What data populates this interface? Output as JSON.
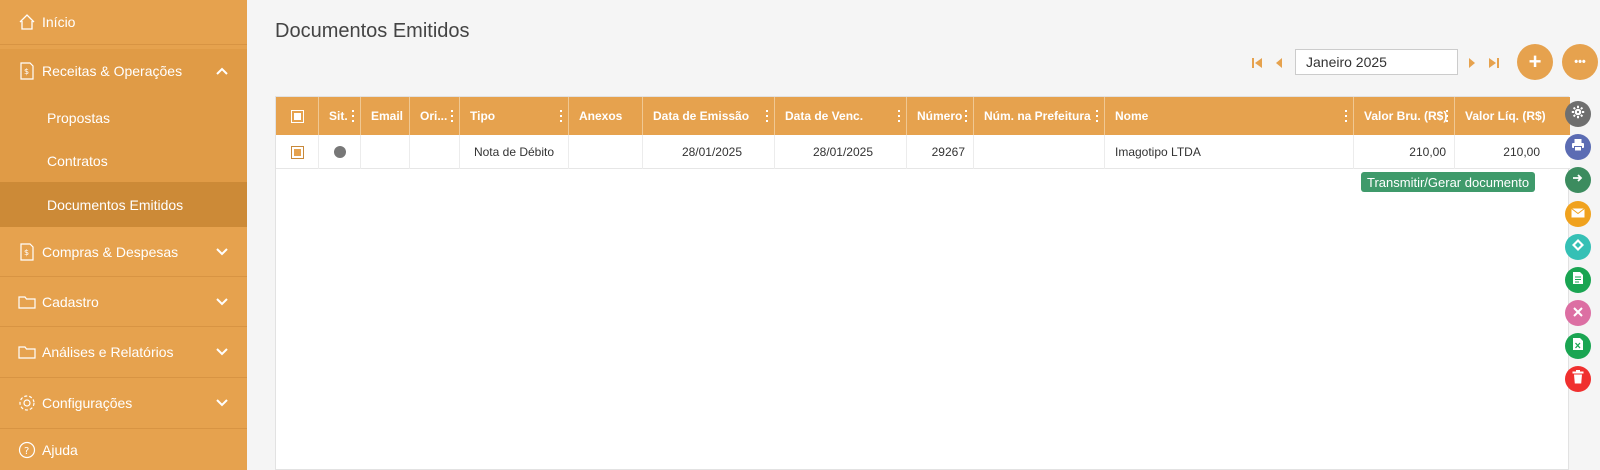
{
  "sidebar": {
    "inicio": "Início",
    "receitas": "Receitas & Operações",
    "propostas": "Propostas",
    "contratos": "Contratos",
    "documentos": "Documentos Emitidos",
    "compras": "Compras & Despesas",
    "cadastro": "Cadastro",
    "analises": "Análises e Relatórios",
    "configuracoes": "Configurações",
    "ajuda": "Ajuda"
  },
  "page": {
    "title": "Documentos Emitidos",
    "month": "Janeiro 2025",
    "add_label": "+",
    "more_label": "•••"
  },
  "table": {
    "headers": {
      "sit": "Sit.",
      "email": "Email",
      "ori": "Ori...",
      "tipo": "Tipo",
      "anexos": "Anexos",
      "emissao": "Data de Emissão",
      "venc": "Data de Venc.",
      "numero": "Número",
      "prefeitura": "Núm. na Prefeitura",
      "nome": "Nome",
      "bruto": "Valor Bru. (R$)",
      "liquido": "Valor Líq. (R$)"
    },
    "rows": [
      {
        "tipo": "Nota de Débito",
        "emissao": "28/01/2025",
        "venc": "28/01/2025",
        "numero": "29267",
        "prefeitura": "",
        "nome": "Imagotipo LTDA",
        "bruto": "210,00",
        "liquido": "210,00"
      }
    ]
  },
  "actions": {
    "tooltip": "Transmitir/Gerar documento"
  },
  "colors": {
    "primary": "#e6a24e",
    "active": "#cc8a37",
    "status": "#777777"
  }
}
